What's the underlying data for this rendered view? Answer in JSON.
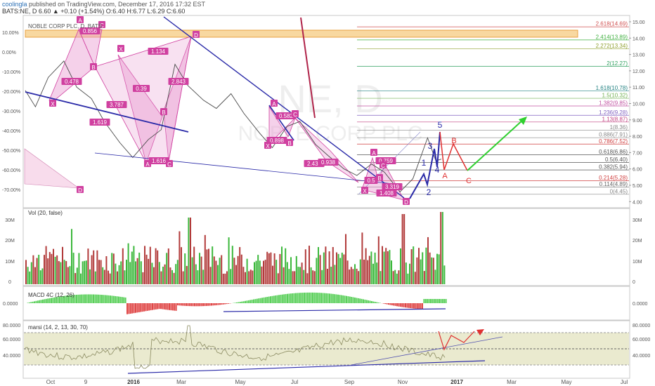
{
  "header": {
    "author": "coolingla",
    "published": "published on TradingView.com, December 17, 2016 17:32 EST",
    "ticker_line": "BATS:NE, D  6.60  ▲ +0.10 (+1.54%)  O:6.40  H:6.77  L:6.29  C:6.60"
  },
  "watermark": {
    "symbol": "NE, D",
    "name": "NOBLE CORP PLC"
  },
  "colors": {
    "up": "#3cb83c",
    "down": "#b23b3b",
    "pattern": "#e040a0",
    "trend": "#2a2aa8",
    "wave_red": "#e03030",
    "wave_green": "#30d030"
  },
  "chart_data": [
    {
      "panel": "price",
      "type": "line",
      "title": "NOBLE CORP PLC, D, BATS",
      "y_axis_right": [
        "15.00",
        "14.00",
        "13.00",
        "12.00",
        "11.00",
        "10.00",
        "9.00",
        "8.00",
        "7.00",
        "6.00",
        "5.00",
        "4.00"
      ],
      "y_axis_left": [
        "10.00%",
        "0.00%",
        "-10.00%",
        "-20.00%",
        "-30.00%",
        "-40.00%",
        "-50.00%",
        "-60.00%",
        "-70.00%"
      ],
      "x_axis_labels": [
        "Oct",
        "9",
        "2016",
        "Mar",
        "May",
        "Jul",
        "Sep",
        "Nov",
        "2017",
        "Mar",
        "May",
        "Jul"
      ],
      "approx_close": [
        [
          "2015-09-20",
          10.8
        ],
        [
          "2015-10-01",
          9.8
        ],
        [
          "2015-10-15",
          11.6
        ],
        [
          "2015-11-01",
          12.6
        ],
        [
          "2015-11-15",
          11.0
        ],
        [
          "2015-12-01",
          10.3
        ],
        [
          "2015-12-15",
          8.9
        ],
        [
          "2016-01-01",
          7.6
        ],
        [
          "2016-01-15",
          6.7
        ],
        [
          "2016-02-01",
          7.8
        ],
        [
          "2016-02-15",
          8.4
        ],
        [
          "2016-03-01",
          12.4
        ],
        [
          "2016-03-15",
          11.1
        ],
        [
          "2016-04-01",
          10.2
        ],
        [
          "2016-04-15",
          9.7
        ],
        [
          "2016-05-01",
          10.6
        ],
        [
          "2016-05-15",
          9.4
        ],
        [
          "2016-06-01",
          8.2
        ],
        [
          "2016-06-15",
          7.3
        ],
        [
          "2016-07-01",
          8.6
        ],
        [
          "2016-07-15",
          8.9
        ],
        [
          "2016-08-01",
          7.5
        ],
        [
          "2016-08-15",
          6.8
        ],
        [
          "2016-09-01",
          6.0
        ],
        [
          "2016-09-15",
          5.6
        ],
        [
          "2016-10-01",
          6.3
        ],
        [
          "2016-10-15",
          5.8
        ],
        [
          "2016-11-01",
          4.6
        ],
        [
          "2016-11-15",
          5.4
        ],
        [
          "2016-12-01",
          7.9
        ],
        [
          "2016-12-10",
          6.5
        ],
        [
          "2016-12-16",
          6.6
        ]
      ],
      "fib_levels": [
        {
          "label": "2.618(14.69)",
          "value": 14.69,
          "color": "#d05050"
        },
        {
          "label": "2.414(13.89)",
          "value": 13.89,
          "color": "#40b040"
        },
        {
          "label": "2.272(13.34)",
          "value": 13.34,
          "color": "#90a030"
        },
        {
          "label": "2(12.27)",
          "value": 12.27,
          "color": "#30a060"
        },
        {
          "label": "1.618(10.78)",
          "value": 10.78,
          "color": "#208080"
        },
        {
          "label": "1.5(10.32)",
          "value": 10.32,
          "color": "#70b050"
        },
        {
          "label": "1.382(9.85)",
          "value": 9.85,
          "color": "#c050a0"
        },
        {
          "label": "1.236(9.28)",
          "value": 9.28,
          "color": "#8060c0"
        },
        {
          "label": "1.13(8.87)",
          "value": 8.87,
          "color": "#c04080"
        },
        {
          "label": "1(8.36)",
          "value": 8.36,
          "color": "#888888"
        },
        {
          "label": "0.886(7.91)",
          "value": 7.91,
          "color": "#888888"
        },
        {
          "label": "0.786(7.52)",
          "value": 7.52,
          "color": "#d04040"
        },
        {
          "label": "0.618(6.86)",
          "value": 6.86,
          "color": "#555555"
        },
        {
          "label": "0.5(6.40)",
          "value": 6.4,
          "color": "#555555"
        },
        {
          "label": "0.382(5.94)",
          "value": 5.94,
          "color": "#555555"
        },
        {
          "label": "0.214(5.28)",
          "value": 5.28,
          "color": "#d04040"
        },
        {
          "label": "0.114(4.89)",
          "value": 4.89,
          "color": "#666666"
        },
        {
          "label": "0(4.45)",
          "value": 4.45,
          "color": "#888888"
        }
      ],
      "pattern_ratios": [
        "0.856",
        "1.134",
        "0.478",
        "0.39",
        "3.787",
        "2.843",
        "1.619",
        "1.616",
        "0.582",
        "0.898",
        "2.434",
        "0.938",
        "0.759",
        "0.5",
        "3.319",
        "1.408"
      ],
      "point_labels": [
        "X",
        "A",
        "B",
        "C",
        "D"
      ],
      "wave_labels": [
        "1",
        "2",
        "3",
        "4",
        "5"
      ],
      "abc_labels": [
        "A",
        "B",
        "C"
      ]
    },
    {
      "panel": "volume",
      "type": "bar",
      "title": "Vol (20, false)",
      "y_axis": [
        "30M",
        "20M",
        "10M",
        "0"
      ]
    },
    {
      "panel": "macd",
      "type": "bar",
      "title": "MACD 4C (12, 26)",
      "y_axis": [
        "0.0000"
      ]
    },
    {
      "panel": "rsi",
      "type": "line",
      "title": "marsi (14, 2, 13, 30, 70)",
      "y_axis": [
        "80.0000",
        "60.0000",
        "40.0000"
      ]
    }
  ]
}
